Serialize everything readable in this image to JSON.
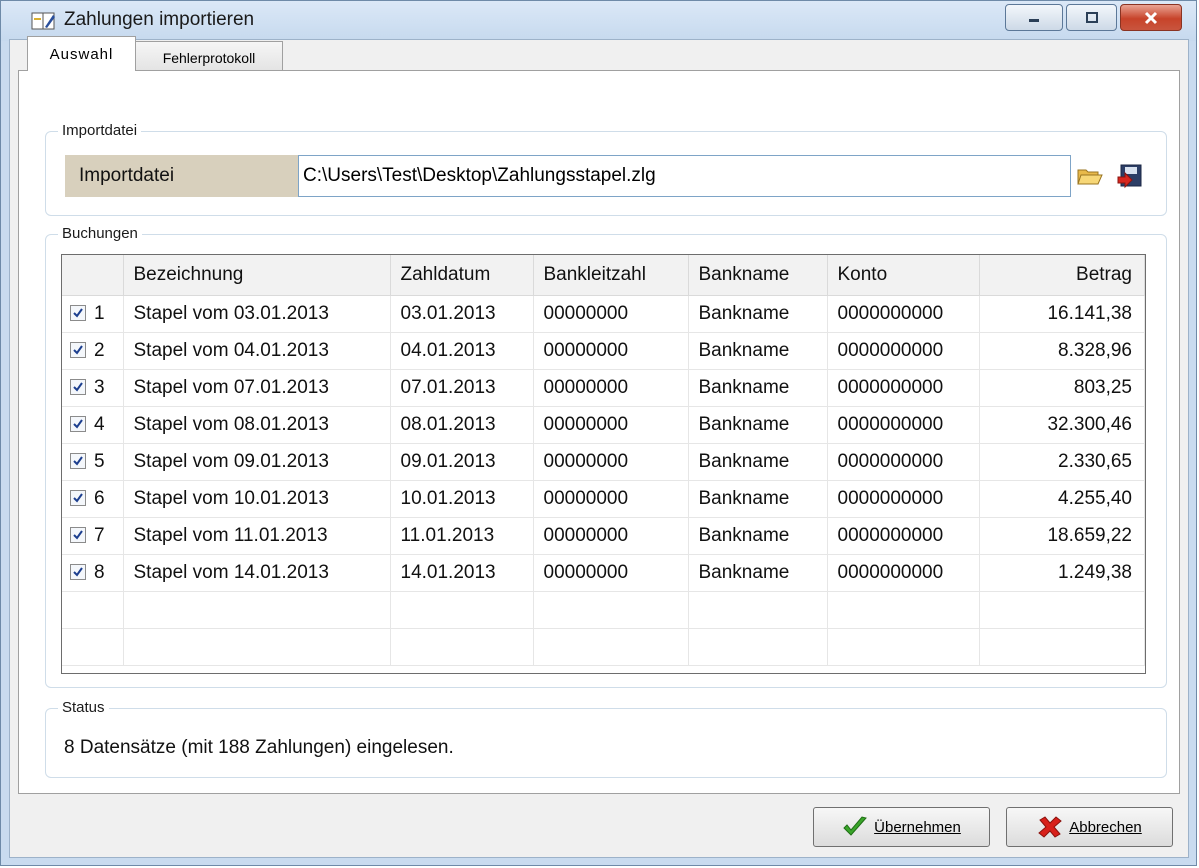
{
  "window": {
    "title": "Zahlungen importieren"
  },
  "tabs": [
    {
      "label": "Auswahl",
      "active": true
    },
    {
      "label": "Fehlerprotokoll",
      "active": false
    }
  ],
  "import_group": {
    "legend": "Importdatei",
    "field_label": "Importdatei",
    "field_value": "C:\\Users\\Test\\Desktop\\Zahlungsstapel.zlg",
    "icons": [
      "folder-open-icon",
      "save-disk-icon"
    ]
  },
  "bookings": {
    "legend": "Buchungen",
    "columns": [
      "",
      "Bezeichnung",
      "Zahldatum",
      "Bankleitzahl",
      "Bankname",
      "Konto",
      "Betrag"
    ],
    "rows": [
      {
        "nr": "1",
        "checked": true,
        "bezeichnung": "Stapel vom 03.01.2013",
        "zahldatum": "03.01.2013",
        "blz": "00000000",
        "bankname": "Bankname",
        "konto": "0000000000",
        "betrag": "16.141,38"
      },
      {
        "nr": "2",
        "checked": true,
        "bezeichnung": "Stapel vom 04.01.2013",
        "zahldatum": "04.01.2013",
        "blz": "00000000",
        "bankname": "Bankname",
        "konto": "0000000000",
        "betrag": "8.328,96"
      },
      {
        "nr": "3",
        "checked": true,
        "bezeichnung": "Stapel vom 07.01.2013",
        "zahldatum": "07.01.2013",
        "blz": "00000000",
        "bankname": "Bankname",
        "konto": "0000000000",
        "betrag": "803,25"
      },
      {
        "nr": "4",
        "checked": true,
        "bezeichnung": "Stapel vom 08.01.2013",
        "zahldatum": "08.01.2013",
        "blz": "00000000",
        "bankname": "Bankname",
        "konto": "0000000000",
        "betrag": "32.300,46"
      },
      {
        "nr": "5",
        "checked": true,
        "bezeichnung": "Stapel vom 09.01.2013",
        "zahldatum": "09.01.2013",
        "blz": "00000000",
        "bankname": "Bankname",
        "konto": "0000000000",
        "betrag": "2.330,65"
      },
      {
        "nr": "6",
        "checked": true,
        "bezeichnung": "Stapel vom 10.01.2013",
        "zahldatum": "10.01.2013",
        "blz": "00000000",
        "bankname": "Bankname",
        "konto": "0000000000",
        "betrag": "4.255,40"
      },
      {
        "nr": "7",
        "checked": true,
        "bezeichnung": "Stapel vom 11.01.2013",
        "zahldatum": "11.01.2013",
        "blz": "00000000",
        "bankname": "Bankname",
        "konto": "0000000000",
        "betrag": "18.659,22"
      },
      {
        "nr": "8",
        "checked": true,
        "bezeichnung": "Stapel vom 14.01.2013",
        "zahldatum": "14.01.2013",
        "blz": "00000000",
        "bankname": "Bankname",
        "konto": "0000000000",
        "betrag": "1.249,38"
      }
    ]
  },
  "status": {
    "legend": "Status",
    "text": "8 Datensätze (mit 188 Zahlungen) eingelesen."
  },
  "buttons": {
    "ok_label": "Übernehmen",
    "cancel_label": "Abbrechen"
  },
  "colors": {
    "titlebar": "#c6d9ee",
    "close_button": "#c7432a",
    "field_label_bg": "#d8d0bd",
    "ok_check": "#3aa52a",
    "cancel_x": "#d8201a"
  }
}
